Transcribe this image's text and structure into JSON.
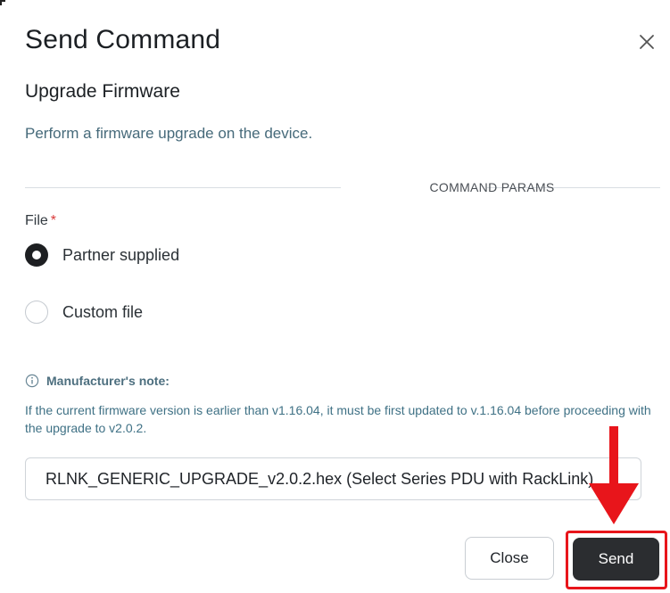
{
  "dialog": {
    "title": "Send Command",
    "command_name": "Upgrade Firmware",
    "description": "Perform a firmware upgrade on the device.",
    "section_label": "COMMAND PARAMS"
  },
  "file_param": {
    "label": "File",
    "required_marker": "*",
    "options": [
      {
        "label": "Partner supplied",
        "selected": true
      },
      {
        "label": "Custom file",
        "selected": false
      }
    ]
  },
  "note": {
    "title": "Manufacturer's note:",
    "text": "If the current firmware version is earlier than v1.16.04, it must be first updated to v.1.16.04 before proceeding with the upgrade to v2.0.2."
  },
  "selected_file": "RLNK_GENERIC_UPGRADE_v2.0.2.hex (Select Series PDU with RackLink)",
  "buttons": {
    "close": "Close",
    "send": "Send"
  },
  "annotation": {
    "color": "#e8151b",
    "target": "send-button"
  }
}
